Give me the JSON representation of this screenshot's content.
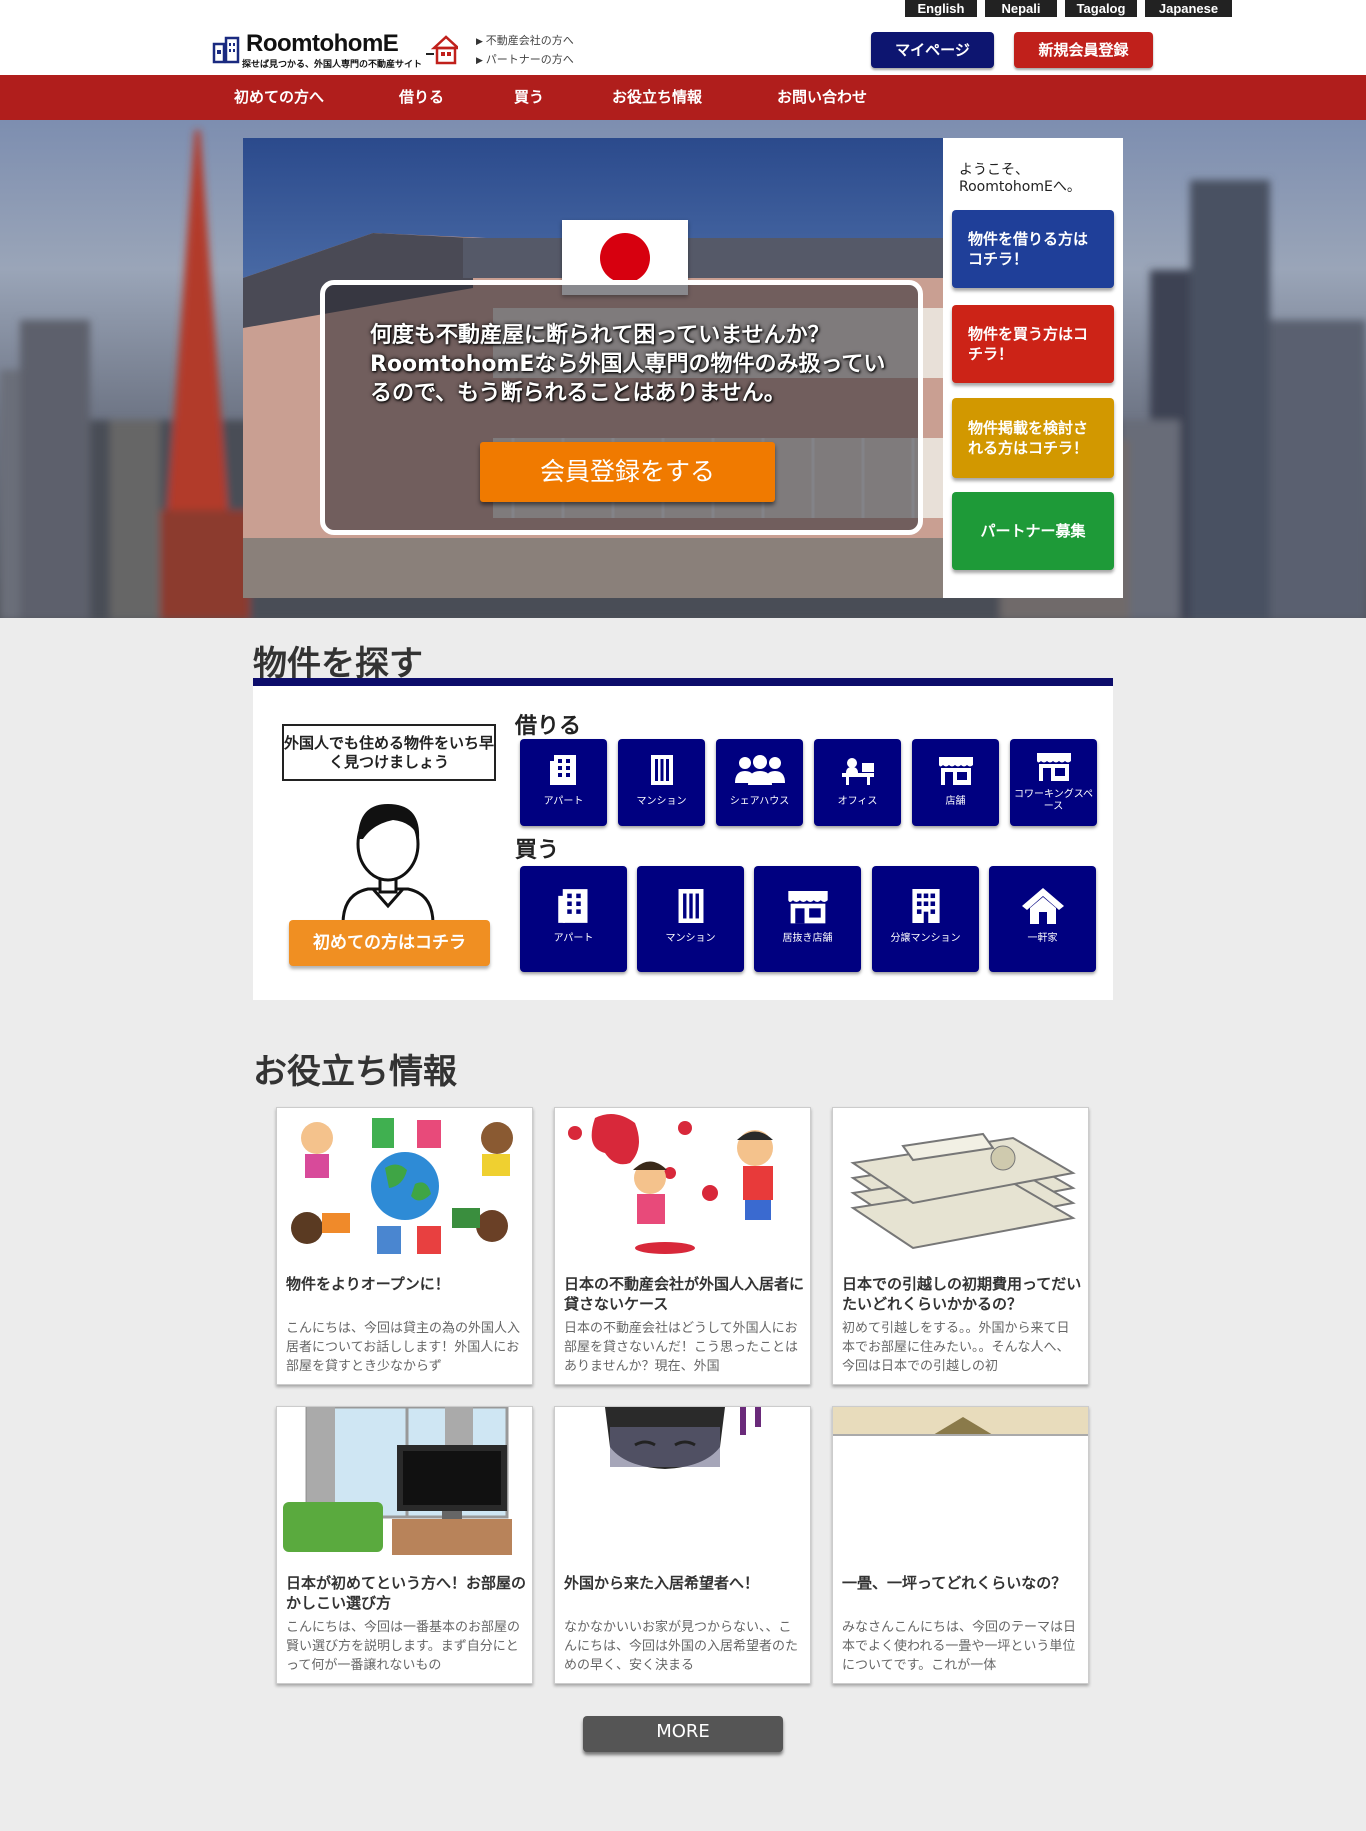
{
  "header": {
    "languages": [
      "English",
      "Nepali",
      "Tagalog",
      "Japanese"
    ],
    "logo_title": "RoomtohomE",
    "logo_subtitle": "探せば見つかる、外国人専門の不動産サイト",
    "sub_links": [
      "不動産会社の方へ",
      "パートナーの方へ"
    ],
    "mypage_label": "マイページ",
    "register_label": "新規会員登録"
  },
  "nav": [
    "初めての方へ",
    "借りる",
    "買う",
    "お役立ち情報",
    "お問い合わせ"
  ],
  "hero": {
    "message": "何度も不動産屋に断られて困っていませんか？RoomtohomEなら外国人専門の物件のみ扱っているので、もう断られることはありません。",
    "cta_label": "会員登録をする",
    "welcome": "ようこそ、RoomtohomEへ。",
    "side_buttons": [
      "物件を借りる方はコチラ！",
      "物件を買う方はコチラ！",
      "物件掲載を検討される方はコチラ！",
      "パートナー募集"
    ]
  },
  "search": {
    "title": "物件を探す",
    "speech": "外国人でも住める物件をいち早く見つけましょう",
    "first_btn": "初めての方はコチラ",
    "rent_label": "借りる",
    "buy_label": "買う",
    "rent_items": [
      {
        "label": "アパート",
        "icon": "apartment-icon"
      },
      {
        "label": "マンション",
        "icon": "mansion-icon"
      },
      {
        "label": "シェアハウス",
        "icon": "sharehouse-icon"
      },
      {
        "label": "オフィス",
        "icon": "office-icon"
      },
      {
        "label": "店舗",
        "icon": "store-icon"
      },
      {
        "label": "コワーキングスペース",
        "icon": "coworking-icon"
      }
    ],
    "buy_items": [
      {
        "label": "アパート",
        "icon": "apartment-icon"
      },
      {
        "label": "マンション",
        "icon": "mansion-icon"
      },
      {
        "label": "居抜き店舗",
        "icon": "store-icon"
      },
      {
        "label": "分譲マンション",
        "icon": "condo-icon"
      },
      {
        "label": "一軒家",
        "icon": "house-icon"
      }
    ]
  },
  "articles": {
    "title": "お役立ち情報",
    "more_label": "MORE",
    "items": [
      {
        "title": "物件をよりオープンに！",
        "body": "こんにちは、今回は貸主の為の外国人入居者についてお話しします！外国人にお部屋を貸すとき少なからず"
      },
      {
        "title": "日本の不動産会社が外国人入居者に貸さないケース",
        "body": "日本の不動産会社はどうして外国人にお部屋を貸さないんだ！こう思ったことはありませんか？現在、外国"
      },
      {
        "title": "日本での引越しの初期費用ってだいたいどれくらいかかるの？",
        "body": "初めて引越しをする。。外国から来て日本でお部屋に住みたい。。そんな人へ、今回は日本での引越しの初"
      },
      {
        "title": "日本が初めてという方へ！お部屋のかしこい選び方",
        "body": "こんにちは、今回は一番基本のお部屋の賢い選び方を説明します。まず自分にとって何が一番譲れないもの"
      },
      {
        "title": "外国から来た入居希望者へ！",
        "body": "なかなかいいお家が見つからない、、こんにちは、今回は外国の入居希望者のための早く、安く決まる"
      },
      {
        "title": "一畳、一坪ってどれくらいなの？",
        "body": "みなさんこんにちは、今回のテーマは日本でよく使われる一畳や一坪という単位についてです。これが一体"
      }
    ]
  }
}
